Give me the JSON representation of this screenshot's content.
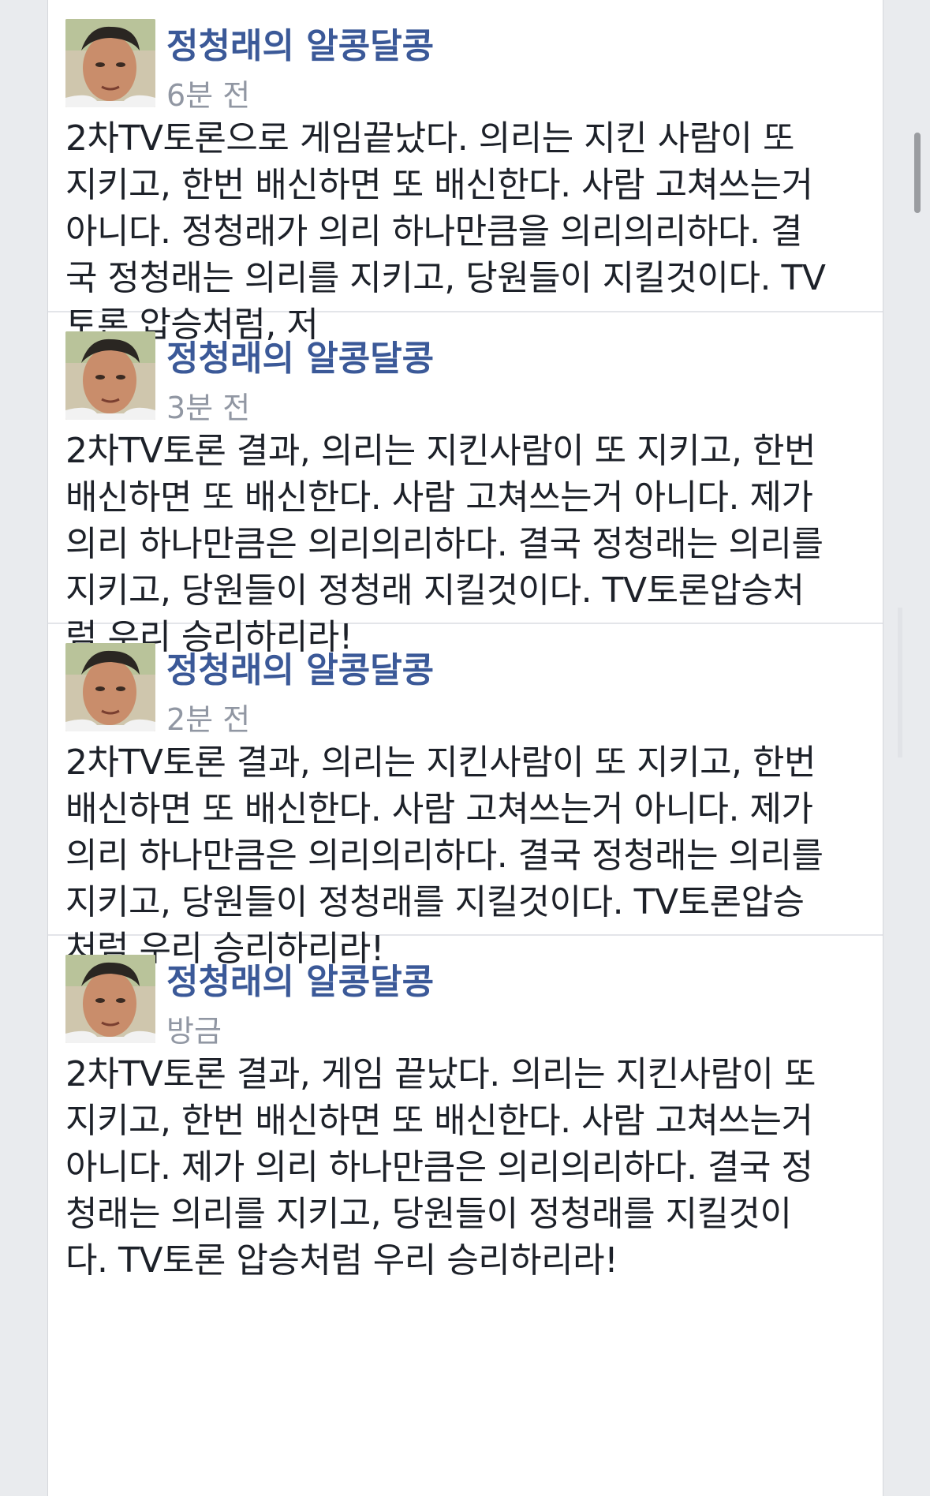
{
  "posts": [
    {
      "author": "정청래의 알콩달콩",
      "time": "6분 전",
      "lines": [
        "2차TV토론으로 게임끝났다. 의리는 지킨 사람이 또",
        "지키고, 한번 배신하면 또 배신한다. 사람 고쳐쓰는거",
        "아니다. 정청래가 의리 하나만큼을 의리의리하다. 결",
        "국 정청래는 의리를 지키고, 당원들이 지킬것이다. TV",
        "토론 압승처럼, 저"
      ]
    },
    {
      "author": "정청래의 알콩달콩",
      "time": "3분 전",
      "lines": [
        "2차TV토론 결과, 의리는 지킨사람이 또 지키고, 한번",
        "배신하면 또 배신한다. 사람 고쳐쓰는거 아니다. 제가",
        "의리 하나만큼은 의리의리하다. 결국 정청래는 의리를",
        "지키고, 당원들이 정청래 지킬것이다. TV토론압승처",
        "럼 우리 승리하리라!"
      ]
    },
    {
      "author": "정청래의 알콩달콩",
      "time": "2분 전",
      "lines": [
        "2차TV토론 결과, 의리는 지킨사람이 또 지키고, 한번",
        "배신하면 또 배신한다. 사람 고쳐쓰는거 아니다. 제가",
        "의리 하나만큼은 의리의리하다. 결국 정청래는 의리를",
        "지키고, 당원들이 정청래를 지킬것이다. TV토론압승",
        "처럼 우리 승리하리라!"
      ]
    },
    {
      "author": "정청래의 알콩달콩",
      "time": "방금",
      "lines": [
        "2차TV토론 결과, 게임 끝났다. 의리는 지킨사람이 또",
        "지키고, 한번 배신하면 또 배신한다. 사람 고쳐쓰는거",
        "아니다. 제가 의리 하나만큼은 의리의리하다. 결국 정",
        "청래는 의리를 지키고, 당원들이 정청래를 지킬것이",
        "다. TV토론 압승처럼 우리 승리하리라!"
      ]
    }
  ],
  "colors": {
    "author": "#3b5998",
    "timestamp": "#9197a3",
    "body_text": "#1d2129",
    "page_background": "#e9ebee",
    "card_background": "#ffffff"
  },
  "icons": {
    "avatar": "profile-photo-icon"
  }
}
